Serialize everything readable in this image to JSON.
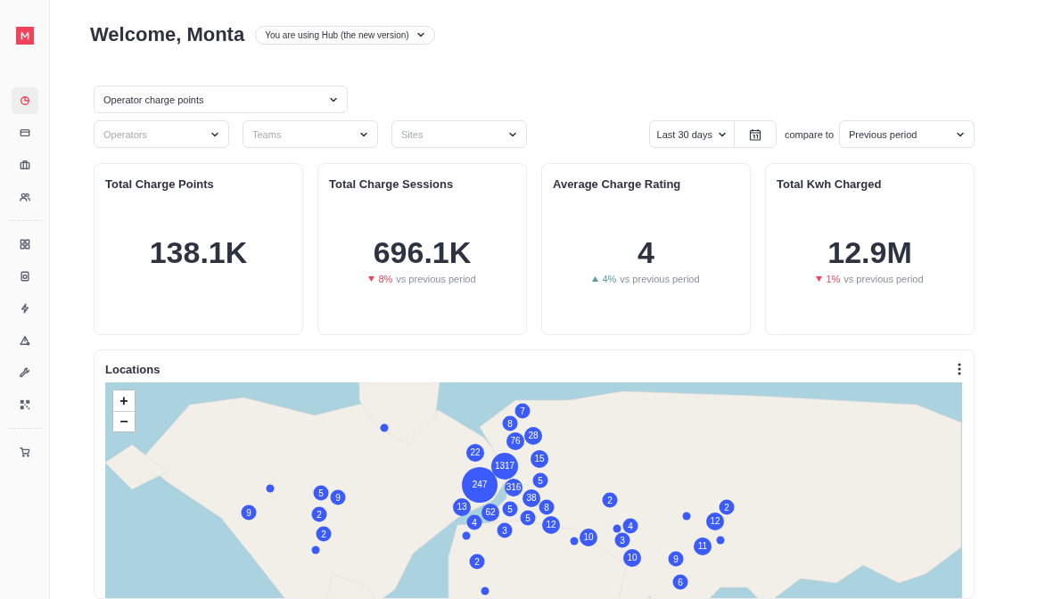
{
  "sidebar": {
    "items": [
      {
        "selected": true
      },
      {
        "selected": false
      },
      {
        "selected": false
      },
      {
        "selected": false
      },
      {
        "selected": false
      },
      {
        "selected": false
      },
      {
        "selected": false
      },
      {
        "selected": false
      },
      {
        "selected": false
      },
      {
        "selected": false
      },
      {
        "selected": false
      }
    ]
  },
  "header": {
    "title": "Welcome, Monta",
    "version_selector": "You are using Hub (the new version)"
  },
  "filters": {
    "view": {
      "value": "Operator charge points"
    },
    "selects": [
      {
        "placeholder": "Operators"
      },
      {
        "placeholder": "Teams"
      },
      {
        "placeholder": "Sites"
      }
    ],
    "period": {
      "value": "Last 30 days"
    },
    "compare_label": "compare to",
    "compare": {
      "value": "Previous period"
    }
  },
  "kpis": [
    {
      "title": "Total Charge Points",
      "value": "138.1K"
    },
    {
      "title": "Total Charge Sessions",
      "value": "696.1K",
      "delta": {
        "kind": "down",
        "percent": "8%",
        "text": "vs previous period"
      }
    },
    {
      "title": "Average Charge Rating",
      "value": "4",
      "delta": {
        "kind": "up",
        "percent": "4%",
        "text": "vs previous period"
      }
    },
    {
      "title": "Total Kwh Charged",
      "value": "12.9M",
      "delta": {
        "kind": "down",
        "percent": "1%",
        "text": "vs previous period"
      }
    }
  ],
  "locations": {
    "title": "Locations",
    "zoom_in": "+",
    "zoom_out": "−",
    "markers": [
      {
        "kind": "small",
        "label": "7"
      },
      {
        "kind": "small",
        "label": "8"
      },
      {
        "kind": "dot"
      },
      {
        "kind": "medium",
        "label": "76"
      },
      {
        "kind": "medium",
        "label": "28"
      },
      {
        "kind": "medium",
        "label": "22"
      },
      {
        "kind": "medium",
        "label": "15"
      },
      {
        "kind": "large",
        "label": "1317"
      },
      {
        "kind": "dot"
      },
      {
        "kind": "huge",
        "label": "247"
      },
      {
        "kind": "medium",
        "label": "316"
      },
      {
        "kind": "small",
        "label": "5"
      },
      {
        "kind": "small",
        "label": "5"
      },
      {
        "kind": "small",
        "label": "9"
      },
      {
        "kind": "medium",
        "label": "38"
      },
      {
        "kind": "small",
        "label": "2"
      },
      {
        "kind": "small",
        "label": "9"
      },
      {
        "kind": "small",
        "label": "2"
      },
      {
        "kind": "medium",
        "label": "13"
      },
      {
        "kind": "medium",
        "label": "62"
      },
      {
        "kind": "small",
        "label": "5"
      },
      {
        "kind": "small",
        "label": "8"
      },
      {
        "kind": "small",
        "label": "2"
      },
      {
        "kind": "small",
        "label": "4"
      },
      {
        "kind": "small",
        "label": "5"
      },
      {
        "kind": "dot"
      },
      {
        "kind": "medium",
        "label": "12"
      },
      {
        "kind": "small",
        "label": "3"
      },
      {
        "kind": "medium",
        "label": "12"
      },
      {
        "kind": "dot"
      },
      {
        "kind": "small",
        "label": "4"
      },
      {
        "kind": "small",
        "label": "2"
      },
      {
        "kind": "dot"
      },
      {
        "kind": "dot"
      },
      {
        "kind": "medium",
        "label": "10"
      },
      {
        "kind": "small",
        "label": "3"
      },
      {
        "kind": "dot"
      },
      {
        "kind": "dot"
      },
      {
        "kind": "medium",
        "label": "11"
      },
      {
        "kind": "small",
        "label": "2"
      },
      {
        "kind": "medium",
        "label": "10"
      },
      {
        "kind": "small",
        "label": "9"
      },
      {
        "kind": "small",
        "label": "6"
      },
      {
        "kind": "dot"
      }
    ]
  }
}
